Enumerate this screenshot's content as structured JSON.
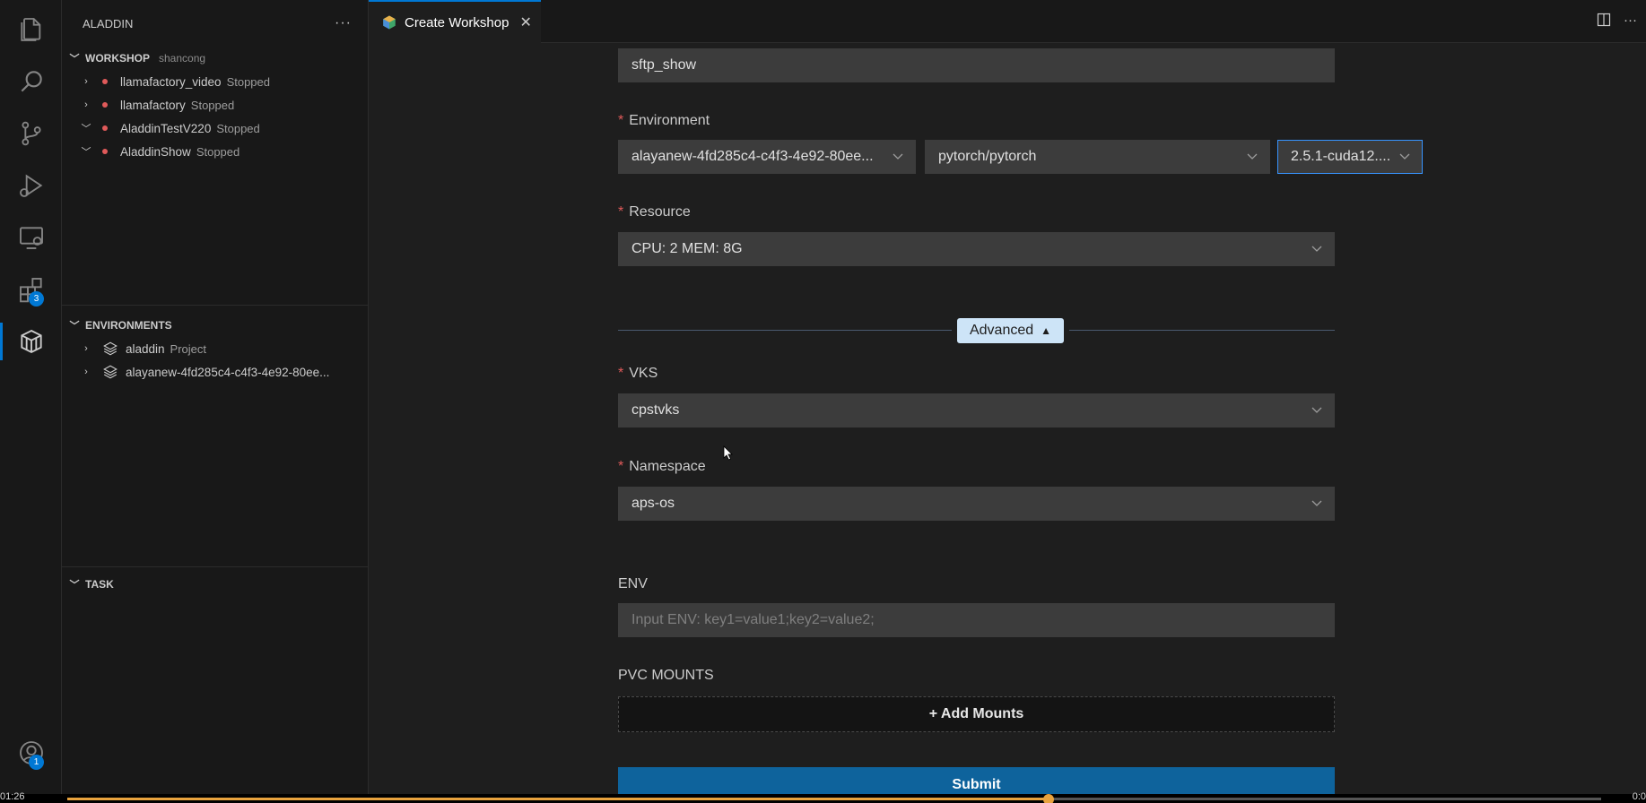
{
  "activity_bar": {
    "items": [
      {
        "icon": "files-icon"
      },
      {
        "icon": "search-icon"
      },
      {
        "icon": "source-control-icon"
      },
      {
        "icon": "run-debug-icon"
      },
      {
        "icon": "remote-explorer-icon"
      },
      {
        "icon": "extensions-icon",
        "badge": "3"
      },
      {
        "icon": "aladdin-icon",
        "active": true
      }
    ],
    "account_badge": "1"
  },
  "sidebar": {
    "title": "ALADDIN",
    "more": "···",
    "workshop": {
      "title": "WORKSHOP",
      "user": "shancong",
      "items": [
        {
          "name": "llamafactory_video",
          "status": "Stopped",
          "expanded": false
        },
        {
          "name": "llamafactory",
          "status": "Stopped",
          "expanded": false
        },
        {
          "name": "AladdinTestV220",
          "status": "Stopped",
          "expanded": true
        },
        {
          "name": "AladdinShow",
          "status": "Stopped",
          "expanded": true
        }
      ]
    },
    "environments": {
      "title": "ENVIRONMENTS",
      "items": [
        {
          "name": "aladdin",
          "desc": "Project"
        },
        {
          "name": "alayanew-4fd285c4-c4f3-4e92-80ee...",
          "desc": ""
        }
      ]
    },
    "task": {
      "title": "TASK"
    }
  },
  "tabs": [
    {
      "label": "Create Workshop",
      "close": "✕"
    }
  ],
  "form": {
    "name_value": "sftp_show",
    "environment": {
      "label": "Environment",
      "env_value": "alayanew-4fd285c4-c4f3-4e92-80ee...",
      "image_value": "pytorch/pytorch",
      "tag_value": "2.5.1-cuda12...."
    },
    "resource": {
      "label": "Resource",
      "value": "CPU: 2 MEM: 8G"
    },
    "advanced_label": "Advanced",
    "vks": {
      "label": "VKS",
      "value": "cpstvks"
    },
    "namespace": {
      "label": "Namespace",
      "value": "aps-os"
    },
    "env": {
      "label": "ENV",
      "placeholder": "Input ENV: key1=value1;key2=value2;"
    },
    "pvc": {
      "label": "PVC MOUNTS",
      "add_label": "+ Add Mounts"
    },
    "submit_label": "Submit"
  },
  "video": {
    "time_left": "01:26",
    "time_right": "0:0",
    "progress": 0.64
  }
}
